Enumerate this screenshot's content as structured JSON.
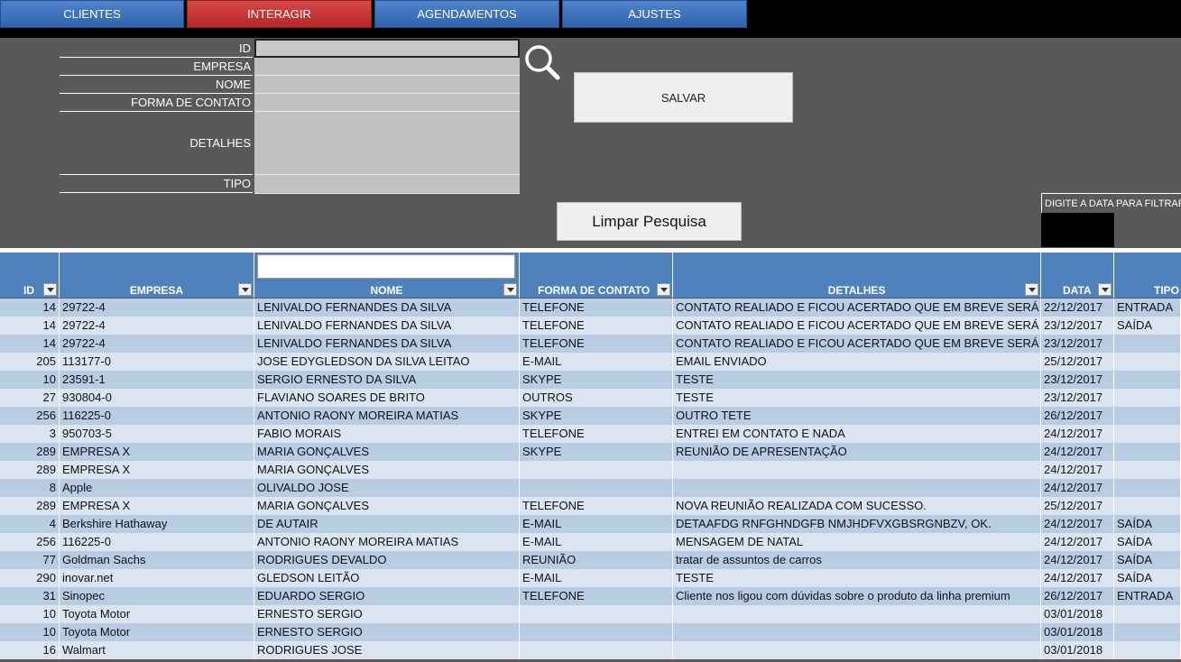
{
  "nav": [
    {
      "label": "CLIENTES",
      "active": false
    },
    {
      "label": "INTERAGIR",
      "active": true
    },
    {
      "label": "AGENDAMENTOS",
      "active": false
    },
    {
      "label": "AJUSTES",
      "active": false
    }
  ],
  "form": {
    "id_label": "ID",
    "empresa_label": "EMPRESA",
    "nome_label": "NOME",
    "forma_label": "FORMA DE CONTATO",
    "detalhes_label": "DETALHES",
    "tipo_label": "TIPO",
    "salvar_label": "SALVAR",
    "limpar_label": "Limpar Pesquisa"
  },
  "filter": {
    "label": "DIGITE A DATA PARA FILTRAR"
  },
  "icons": {
    "search": "search-icon",
    "dropdown": "chevron-down-icon"
  },
  "colors": {
    "header": "#4f81bd",
    "row_odd": "#b8cce4",
    "row_even": "#dbe5f1",
    "active_tab": "#c9302c",
    "tab": "#3a6fb8"
  },
  "table": {
    "headers": {
      "id": "ID",
      "empresa": "EMPRESA",
      "nome": "NOME",
      "forma": "FORMA DE CONTATO",
      "detalhes": "DETALHES",
      "data": "DATA",
      "tipo": "TIPO"
    },
    "rows": [
      {
        "id": "14",
        "empresa": "29722-4",
        "nome": "LENIVALDO FERNANDES DA SILVA",
        "forma": "TELEFONE",
        "detalhes": "CONTATO REALIADO E FICOU ACERTADO QUE EM BREVE SERÁ MOS",
        "data": "22/12/2017",
        "tipo": "ENTRADA"
      },
      {
        "id": "14",
        "empresa": "29722-4",
        "nome": "LENIVALDO FERNANDES DA SILVA",
        "forma": "TELEFONE",
        "detalhes": "CONTATO REALIADO E FICOU ACERTADO QUE EM BREVE SERÁ MOS",
        "data": "23/12/2017",
        "tipo": "SAÍDA"
      },
      {
        "id": "14",
        "empresa": "29722-4",
        "nome": "LENIVALDO FERNANDES DA SILVA",
        "forma": "TELEFONE",
        "detalhes": "CONTATO REALIADO E FICOU ACERTADO QUE EM BREVE SERÁ MOS",
        "data": "23/12/2017",
        "tipo": ""
      },
      {
        "id": "205",
        "empresa": "113177-0",
        "nome": "JOSE EDYGLEDSON DA SILVA LEITAO",
        "forma": "E-MAIL",
        "detalhes": "EMAIL ENVIADO",
        "data": "25/12/2017",
        "tipo": ""
      },
      {
        "id": "10",
        "empresa": "23591-1",
        "nome": "SERGIO ERNESTO DA SILVA",
        "forma": "SKYPE",
        "detalhes": "TESTE",
        "data": "23/12/2017",
        "tipo": ""
      },
      {
        "id": "27",
        "empresa": "930804-0",
        "nome": "FLAVIANO SOARES DE BRITO",
        "forma": "OUTROS",
        "detalhes": "TESTE",
        "data": "23/12/2017",
        "tipo": ""
      },
      {
        "id": "256",
        "empresa": "116225-0",
        "nome": "ANTONIO RAONY MOREIRA MATIAS",
        "forma": "SKYPE",
        "detalhes": "OUTRO TETE",
        "data": "26/12/2017",
        "tipo": ""
      },
      {
        "id": "3",
        "empresa": "950703-5",
        "nome": "FABIO MORAIS",
        "forma": "TELEFONE",
        "detalhes": "ENTREI EM CONTATO E NADA",
        "data": "24/12/2017",
        "tipo": ""
      },
      {
        "id": "289",
        "empresa": "EMPRESA X",
        "nome": "MARIA GONÇALVES",
        "forma": "SKYPE",
        "detalhes": "REUNIÃO DE APRESENTAÇÃO",
        "data": "24/12/2017",
        "tipo": ""
      },
      {
        "id": "289",
        "empresa": "EMPRESA X",
        "nome": "MARIA GONÇALVES",
        "forma": "",
        "detalhes": "",
        "data": "24/12/2017",
        "tipo": ""
      },
      {
        "id": "8",
        "empresa": "Apple",
        "nome": "OLIVALDO JOSE",
        "forma": "",
        "detalhes": "",
        "data": "24/12/2017",
        "tipo": ""
      },
      {
        "id": "289",
        "empresa": "EMPRESA X",
        "nome": "MARIA GONÇALVES",
        "forma": "TELEFONE",
        "detalhes": "NOVA REUNIÃO REALIZADA COM SUCESSO.",
        "data": "25/12/2017",
        "tipo": ""
      },
      {
        "id": "4",
        "empresa": "Berkshire Hathaway",
        "nome": "DE AUTAIR",
        "forma": "E-MAIL",
        "detalhes": "DETAAFDG RNFGHNDGFB NMJHDFVXGBSRGNBZV, OK.",
        "data": "24/12/2017",
        "tipo": "SAÍDA"
      },
      {
        "id": "256",
        "empresa": "116225-0",
        "nome": "ANTONIO RAONY MOREIRA MATIAS",
        "forma": "E-MAIL",
        "detalhes": "MENSAGEM DE NATAL",
        "data": "24/12/2017",
        "tipo": "SAÍDA"
      },
      {
        "id": "77",
        "empresa": "Goldman Sachs",
        "nome": "RODRIGUES DEVALDO",
        "forma": "REUNIÃO",
        "detalhes": "tratar de assuntos de carros",
        "data": "24/12/2017",
        "tipo": "SAÍDA"
      },
      {
        "id": "290",
        "empresa": "inovar.net",
        "nome": "GLEDSON LEITÃO",
        "forma": "E-MAIL",
        "detalhes": "TESTE",
        "data": "24/12/2017",
        "tipo": "SAÍDA"
      },
      {
        "id": "31",
        "empresa": "Sinopec",
        "nome": "EDUARDO SERGIO",
        "forma": "TELEFONE",
        "detalhes": "Cliente nos ligou com dúvidas sobre o produto da linha premium",
        "data": "26/12/2017",
        "tipo": "ENTRADA"
      },
      {
        "id": "10",
        "empresa": "Toyota Motor",
        "nome": "ERNESTO SERGIO",
        "forma": "",
        "detalhes": "",
        "data": "03/01/2018",
        "tipo": ""
      },
      {
        "id": "10",
        "empresa": "Toyota Motor",
        "nome": "ERNESTO SERGIO",
        "forma": "",
        "detalhes": "",
        "data": "03/01/2018",
        "tipo": ""
      },
      {
        "id": "16",
        "empresa": "Walmart",
        "nome": "RODRIGUES JOSE",
        "forma": "",
        "detalhes": "",
        "data": "03/01/2018",
        "tipo": ""
      }
    ]
  }
}
